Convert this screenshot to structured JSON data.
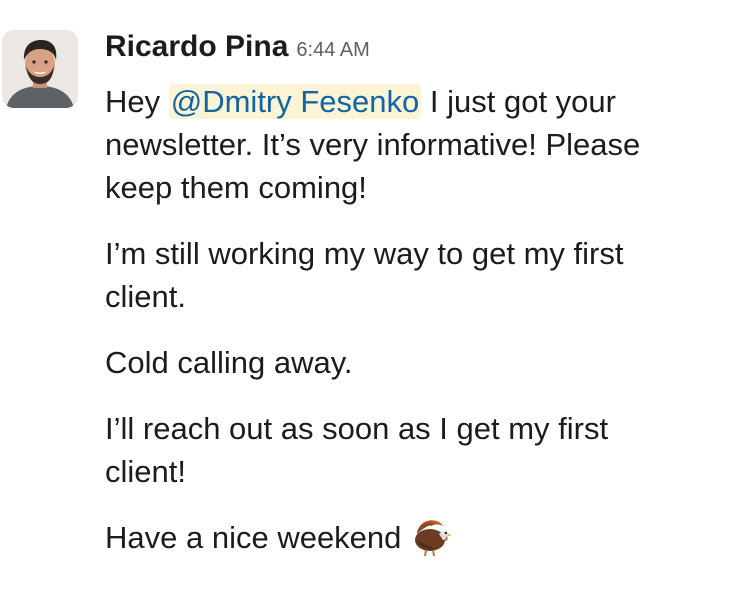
{
  "message": {
    "sender": "Ricardo Pina",
    "timestamp": "6:44 AM",
    "avatar_icon": "user-photo-avatar",
    "paragraphs": [
      {
        "lines": [
          {
            "before": "Hey ",
            "mention": "@Dmitry Fesenko",
            "after": " I just got your"
          },
          {
            "text": "newsletter. It’s very informative! Please"
          },
          {
            "text": "keep them coming!"
          }
        ]
      },
      {
        "lines": [
          {
            "text": "I’m still working my way to get my first"
          },
          {
            "text": "client."
          }
        ]
      },
      {
        "lines": [
          {
            "text": "Cold calling away."
          }
        ]
      },
      {
        "lines": [
          {
            "text": "I’ll reach out as soon as I get my first"
          },
          {
            "text": "client!"
          }
        ]
      },
      {
        "lines": [
          {
            "text": "Have a nice weekend",
            "emoji": "turkey-emoji"
          }
        ]
      }
    ],
    "colors": {
      "mention_text": "#1264a3",
      "mention_bg": "#fcf4d6",
      "text": "#1d1c1d",
      "timestamp": "#616061"
    }
  }
}
